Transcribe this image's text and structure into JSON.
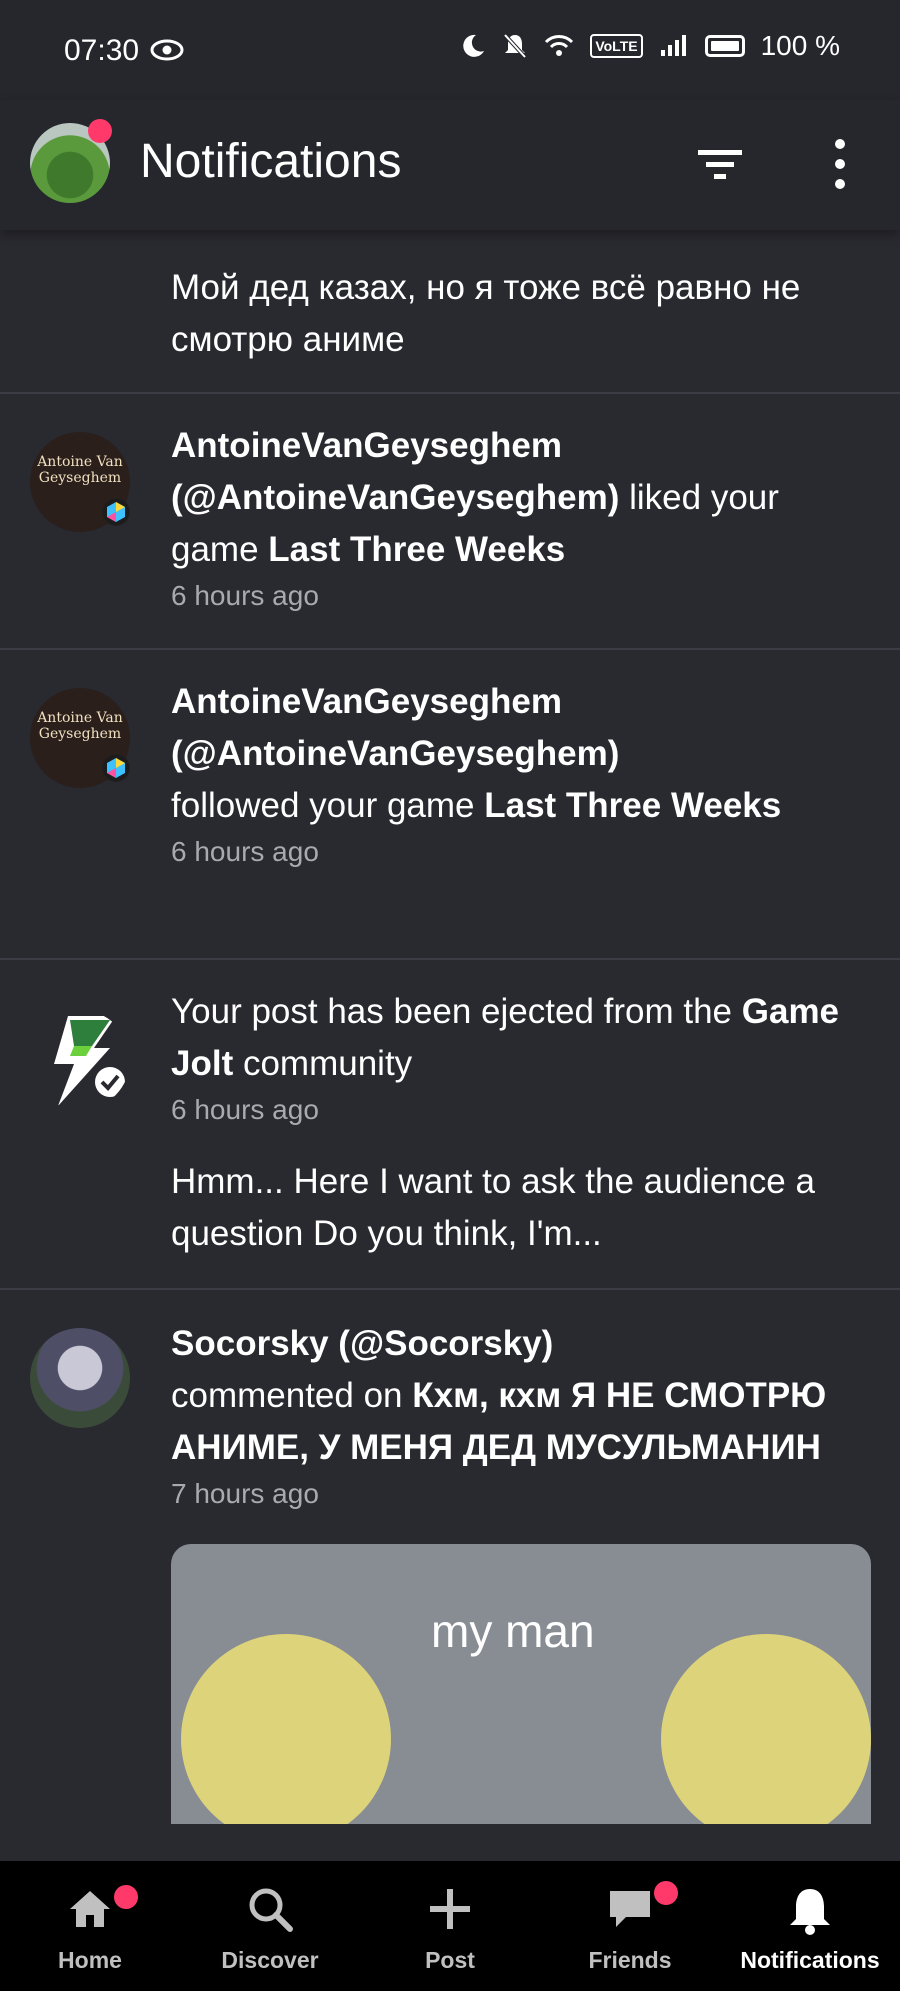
{
  "status_bar": {
    "time": "07:30",
    "battery": "100 %",
    "volte": "VoLTE"
  },
  "header": {
    "title": "Notifications"
  },
  "feed": {
    "top_snippet": "Мой дед казах, но я тоже всё равно не смотрю аниме",
    "items": [
      {
        "avatar_text": "Antoine Van Geyseghem",
        "user": "AntoineVanGeyseghem",
        "handle": "(@AntoineVanGeyseghem)",
        "action": " liked your game ",
        "target": "Last Three Weeks",
        "time": "6 hours ago"
      },
      {
        "avatar_text": "Antoine Van Geyseghem",
        "user": "AntoineVanGeyseghem",
        "handle": "(@AntoineVanGeyseghem)",
        "action": "followed your game ",
        "target": "Last Three Weeks",
        "time": "6 hours ago"
      },
      {
        "pre": "Your post has been ejected from the ",
        "target": "Game Jolt",
        "post": " community",
        "time": "6 hours ago",
        "snippet": "Hmm... Here I want to ask the audience a question Do you think, I'm..."
      },
      {
        "user_handle": "Socorsky (@Socorsky)",
        "action": "commented on ",
        "target": "Кхм, кхм Я НЕ СМОТРЮ АНИМЕ, У МЕНЯ ДЕД МУСУЛЬМАНИН",
        "time": "7 hours ago",
        "image_caption": "my man"
      }
    ]
  },
  "nav": [
    {
      "label": "Home",
      "icon": "home-icon"
    },
    {
      "label": "Discover",
      "icon": "search-icon"
    },
    {
      "label": "Post",
      "icon": "plus-icon"
    },
    {
      "label": "Friends",
      "icon": "chat-icon"
    },
    {
      "label": "Notifications",
      "icon": "bell-icon"
    }
  ],
  "colors": {
    "accent_dot": "#ff3a6b",
    "background": "#292930",
    "header": "#26262d"
  }
}
